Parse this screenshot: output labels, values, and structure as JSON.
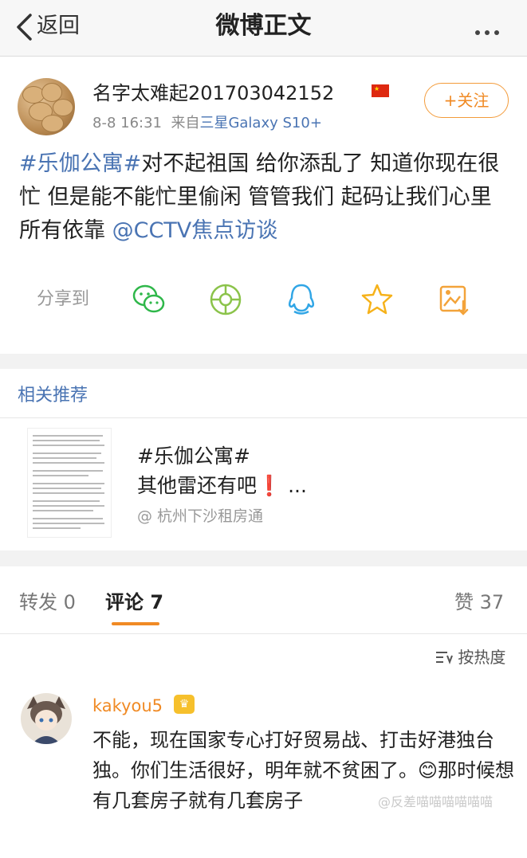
{
  "nav": {
    "back_label": "返回",
    "title": "微博正文",
    "more_icon": "more-dots-icon"
  },
  "post": {
    "username": "名字太难起201703042152",
    "follow_label": "+关注",
    "time": "8-8 16:31",
    "source_prefix": "来自",
    "source": "三星Galaxy S10+",
    "hashtag": "#乐伽公寓#",
    "text_part1": "对不起祖国 给你添乱了 知道你现在很忙 但是能不能忙里偷闲 管管我们 起码让我们心里所有依靠 ",
    "mention": "@CCTV焦点访谈",
    "share_label": "分享到",
    "share_icons": [
      "wechat-icon",
      "moments-icon",
      "qq-icon",
      "qzone-icon",
      "save-image-icon"
    ]
  },
  "recommend": {
    "title": "相关推荐",
    "line1": "#乐伽公寓#",
    "line2": "其他雷还有吧❗ ...",
    "source": "@ 杭州下沙租房通"
  },
  "tabs": {
    "repost": "转发 0",
    "comment": "评论 7",
    "like": "赞 37",
    "sort": "按热度"
  },
  "comment": {
    "name": "kakyou5",
    "text": "不能，现在国家专心打好贸易战、打击好港独台独。你们生活很好，明年就不贫困了。😊那时候想有几套房子就有几套房子",
    "badge": "♛"
  },
  "watermark": "@反差喵喵喵喵喵喵",
  "colors": {
    "accent": "#f08a24",
    "link": "#4a74b3"
  }
}
